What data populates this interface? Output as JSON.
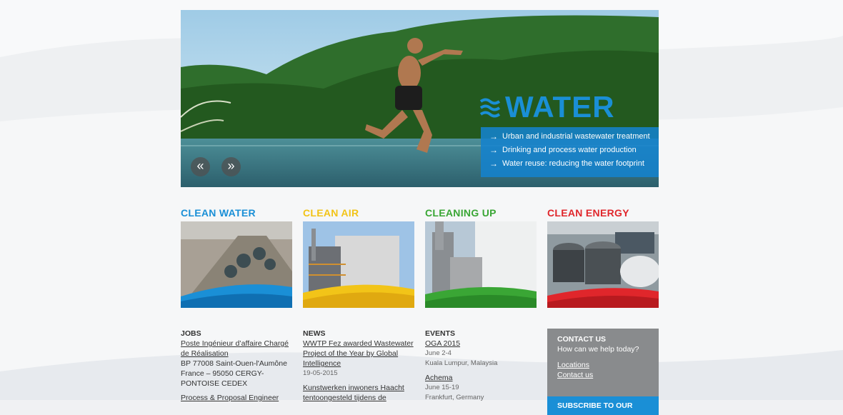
{
  "hero": {
    "title": "WATER",
    "bullets": [
      "Urban and industrial wastewater treatment",
      "Drinking and process water production",
      "Water reuse: reducing the water footprint"
    ],
    "prev_label": "«",
    "next_label": "»"
  },
  "categories": [
    {
      "label": "CLEAN WATER",
      "color": "#1a8fd6"
    },
    {
      "label": "CLEAN AIR",
      "color": "#f2c418"
    },
    {
      "label": "CLEANING UP",
      "color": "#3aa635"
    },
    {
      "label": "CLEAN ENERGY",
      "color": "#e0262b"
    }
  ],
  "jobs": {
    "heading": "JOBS",
    "items": [
      {
        "title": "Poste Ingénieur d’affaire Chargé de Réalisation",
        "address": "BP 77008 Saint-Ouen-l'Aumône France – 95050 CERGY-PONTOISE CEDEX"
      },
      {
        "title": "Process & Proposal Engineer"
      }
    ]
  },
  "news": {
    "heading": "NEWS",
    "items": [
      {
        "title": "WWTP Fez awarded Wastewater Project of the Year by Global Intelligence",
        "date": "19-05-2015"
      },
      {
        "title": "Kunstwerken inwoners Haacht tentoongesteld tijdens de"
      }
    ]
  },
  "events": {
    "heading": "EVENTS",
    "items": [
      {
        "title": "OGA 2015",
        "date": "June 2-4",
        "place": "Kuala Lumpur, Malaysia"
      },
      {
        "title": "Achema",
        "date": "June 15-19",
        "place": "Frankfurt, Germany"
      }
    ]
  },
  "contact": {
    "heading": "CONTACT US",
    "tagline": "How can we help today?",
    "links": [
      "Locations",
      "Contact us"
    ],
    "subscribe": "SUBSCRIBE TO OUR"
  }
}
